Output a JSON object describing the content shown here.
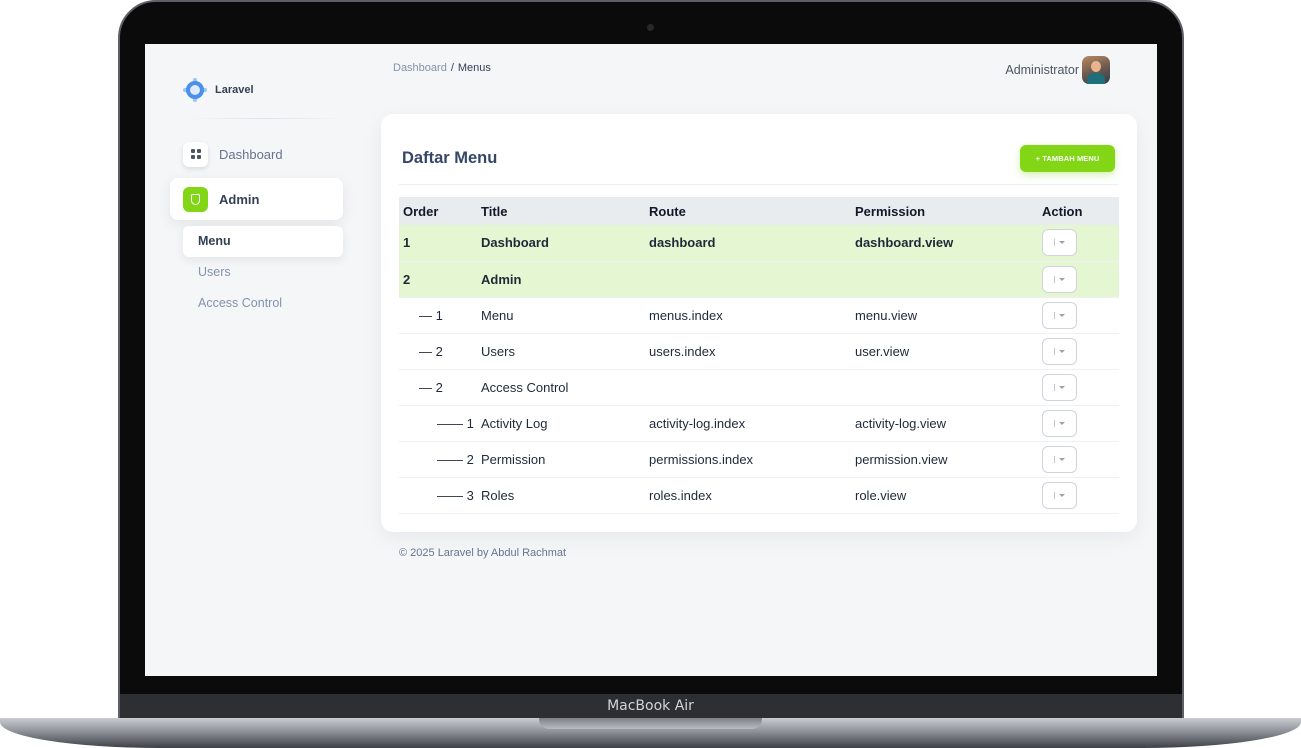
{
  "device": {
    "label": "MacBook Air"
  },
  "brand": {
    "name": "Laravel"
  },
  "sidebar": {
    "items": [
      {
        "label": "Dashboard",
        "icon": "grid-icon"
      },
      {
        "label": "Admin",
        "icon": "shield-icon",
        "active": true
      }
    ],
    "subitems": [
      {
        "label": "Menu",
        "active": true
      },
      {
        "label": "Users"
      },
      {
        "label": "Access Control"
      }
    ]
  },
  "breadcrumb": {
    "parent": "Dashboard",
    "separator": "/",
    "current": "Menus"
  },
  "user": {
    "name": "Administrator"
  },
  "card": {
    "title": "Daftar Menu",
    "add_label": "+ TAMBAH MENU",
    "columns": [
      "Order",
      "Title",
      "Route",
      "Permission",
      "Action"
    ],
    "rows": [
      {
        "order": "1",
        "title": "Dashboard",
        "route": "dashboard",
        "permission": "dashboard.view",
        "level": 0
      },
      {
        "order": "2",
        "title": "Admin",
        "route": "",
        "permission": "",
        "level": 0
      },
      {
        "order": "— 1",
        "title": "Menu",
        "route": "menus.index",
        "permission": "menu.view",
        "level": 1
      },
      {
        "order": "— 2",
        "title": "Users",
        "route": "users.index",
        "permission": "user.view",
        "level": 1
      },
      {
        "order": "— 2",
        "title": "Access Control",
        "route": "",
        "permission": "",
        "level": 1
      },
      {
        "order": "—— 1",
        "title": "Activity Log",
        "route": "activity-log.index",
        "permission": "activity-log.view",
        "level": 2
      },
      {
        "order": "—— 2",
        "title": "Permission",
        "route": "permissions.index",
        "permission": "permission.view",
        "level": 2
      },
      {
        "order": "—— 3",
        "title": "Roles",
        "route": "roles.index",
        "permission": "role.view",
        "level": 2
      }
    ]
  },
  "footer": {
    "text": "© 2025 Laravel by Abdul Rachmat"
  },
  "colors": {
    "accent": "#82d616",
    "highlight_row": "#e5f7d2",
    "header_bg": "#e9ecef"
  }
}
